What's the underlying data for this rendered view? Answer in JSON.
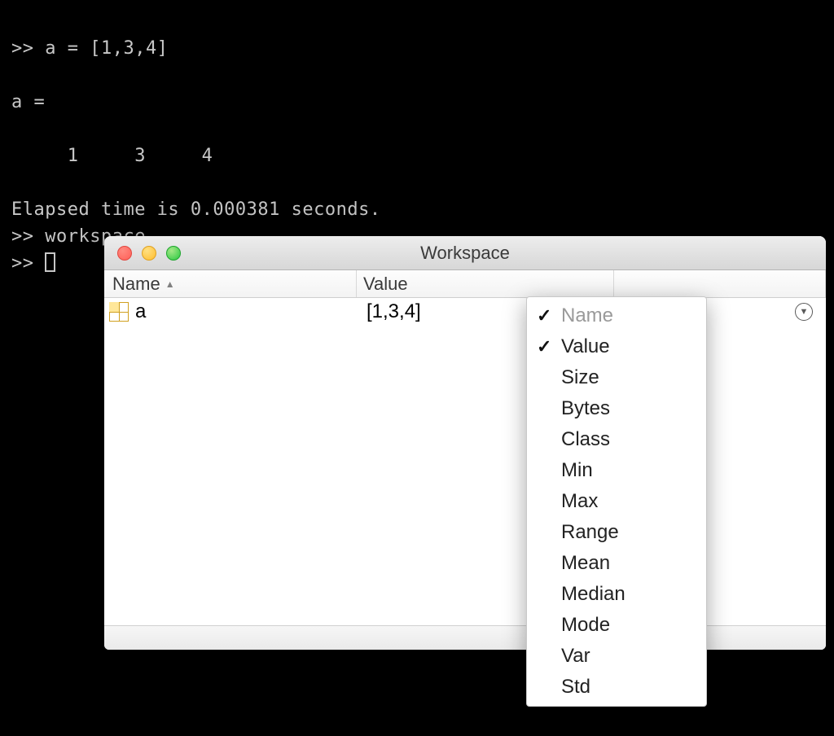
{
  "terminal": {
    "line1": ">> a = [1,3,4]",
    "line2": "",
    "line3": "a =",
    "line4": "",
    "line5": "     1     3     4",
    "line6": "",
    "line7": "Elapsed time is 0.000381 seconds.",
    "line8": ">> workspace",
    "line9_prefix": ">> "
  },
  "workspace": {
    "title": "Workspace",
    "columns": {
      "name": "Name",
      "value": "Value"
    },
    "rows": [
      {
        "name": "a",
        "value": "[1,3,4]"
      }
    ]
  },
  "menu": {
    "items": [
      {
        "label": "Name",
        "checked": true,
        "disabled": true
      },
      {
        "label": "Value",
        "checked": true,
        "disabled": false
      },
      {
        "label": "Size",
        "checked": false,
        "disabled": false
      },
      {
        "label": "Bytes",
        "checked": false,
        "disabled": false
      },
      {
        "label": "Class",
        "checked": false,
        "disabled": false
      },
      {
        "label": "Min",
        "checked": false,
        "disabled": false
      },
      {
        "label": "Max",
        "checked": false,
        "disabled": false
      },
      {
        "label": "Range",
        "checked": false,
        "disabled": false
      },
      {
        "label": "Mean",
        "checked": false,
        "disabled": false
      },
      {
        "label": "Median",
        "checked": false,
        "disabled": false
      },
      {
        "label": "Mode",
        "checked": false,
        "disabled": false
      },
      {
        "label": "Var",
        "checked": false,
        "disabled": false
      },
      {
        "label": "Std",
        "checked": false,
        "disabled": false
      }
    ]
  }
}
